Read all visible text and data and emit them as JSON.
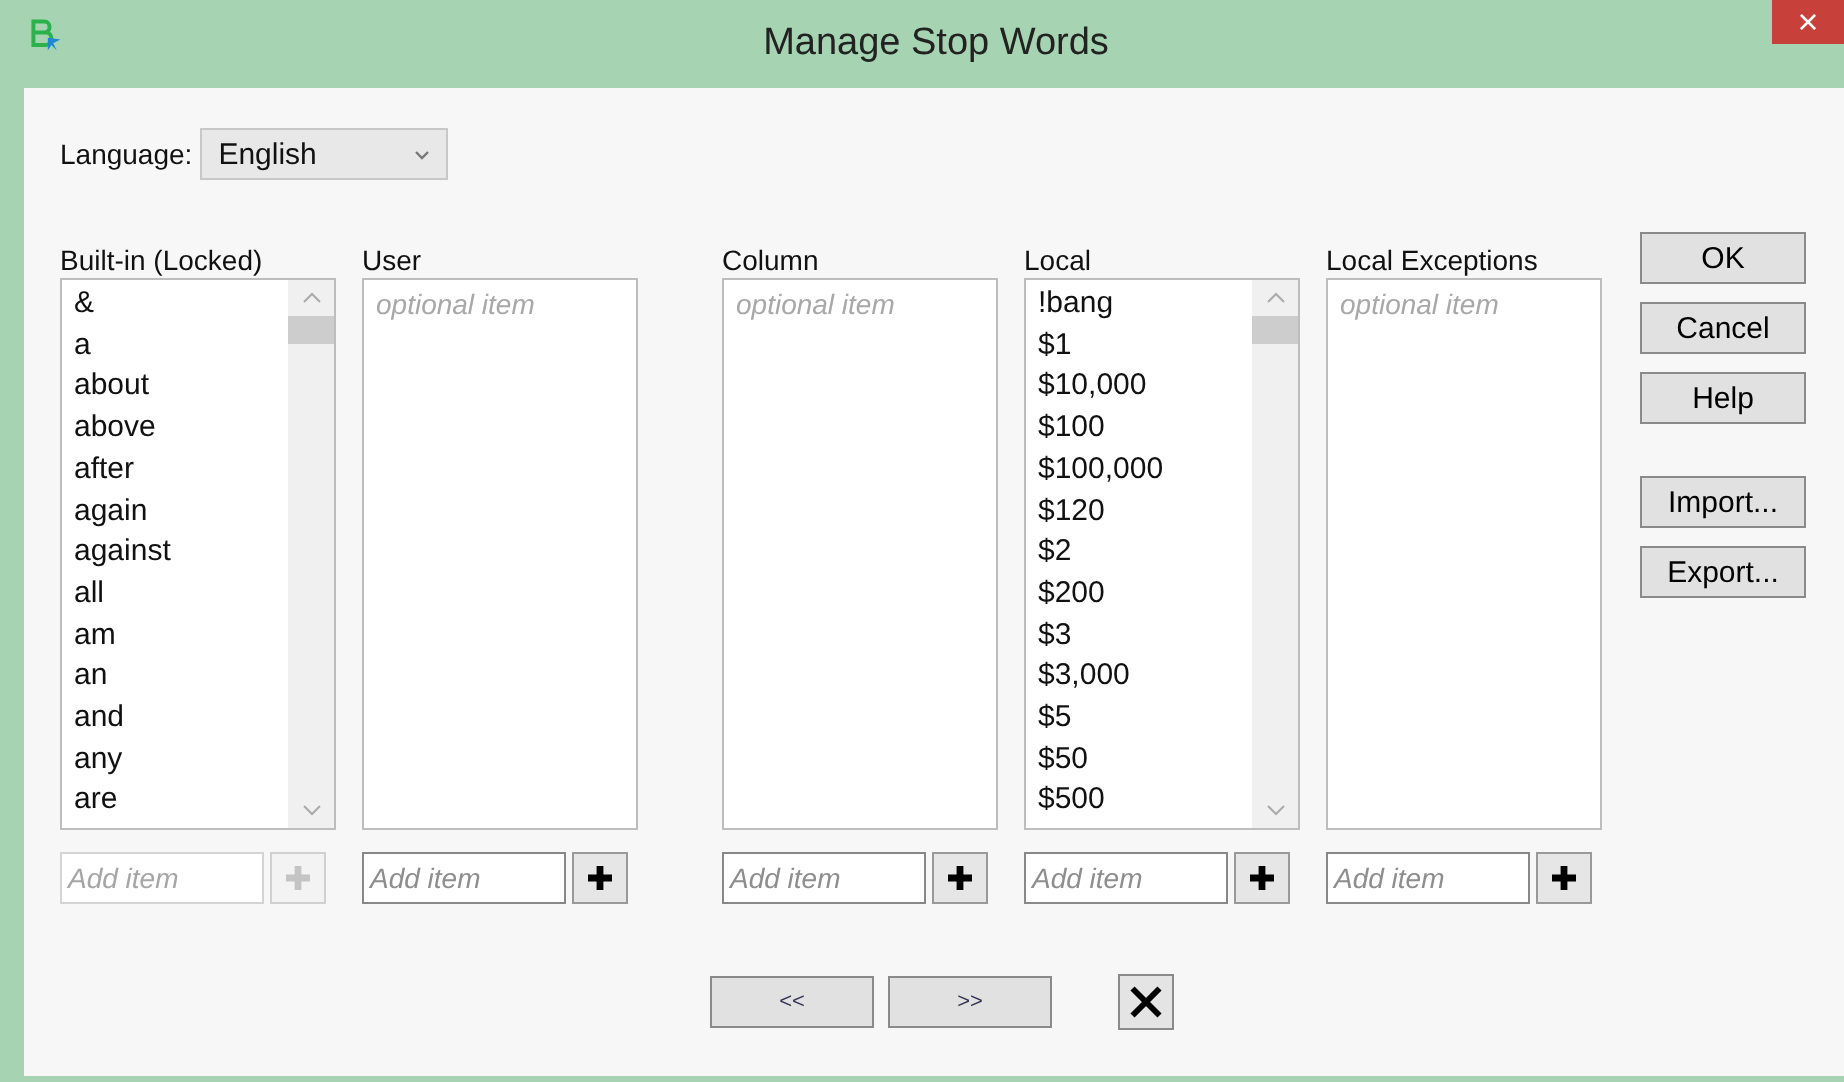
{
  "window": {
    "title": "Manage Stop Words",
    "close": "×"
  },
  "language": {
    "label": "Language:",
    "value": "English"
  },
  "lists": [
    {
      "heading": "Built-in (Locked)",
      "scrollbar": true,
      "items": [
        "&",
        "a",
        "about",
        "above",
        "after",
        "again",
        "against",
        "all",
        "am",
        "an",
        "and",
        "any",
        "are"
      ],
      "add": {
        "placeholder": "Add item",
        "disabled": true
      }
    },
    {
      "heading": "User",
      "placeholder": "optional item",
      "scrollbar": false,
      "add": {
        "placeholder": "Add item",
        "disabled": false
      }
    },
    {
      "heading": "Column",
      "placeholder": "optional item",
      "scrollbar": false,
      "add": {
        "placeholder": "Add item",
        "disabled": false
      }
    },
    {
      "heading": "Local",
      "scrollbar": true,
      "items": [
        "!bang",
        "$1",
        "$10,000",
        "$100",
        "$100,000",
        "$120",
        "$2",
        "$200",
        "$3",
        "$3,000",
        "$5",
        "$50",
        "$500"
      ],
      "add": {
        "placeholder": "Add item",
        "disabled": false
      }
    },
    {
      "heading": "Local Exceptions",
      "placeholder": "optional item",
      "scrollbar": false,
      "add": {
        "placeholder": "Add item",
        "disabled": false
      }
    }
  ],
  "buttons": [
    "OK",
    "Cancel",
    "Help"
  ],
  "file_buttons": [
    "Import...",
    "Export..."
  ],
  "nav": {
    "prev": "<<",
    "next": ">>"
  }
}
